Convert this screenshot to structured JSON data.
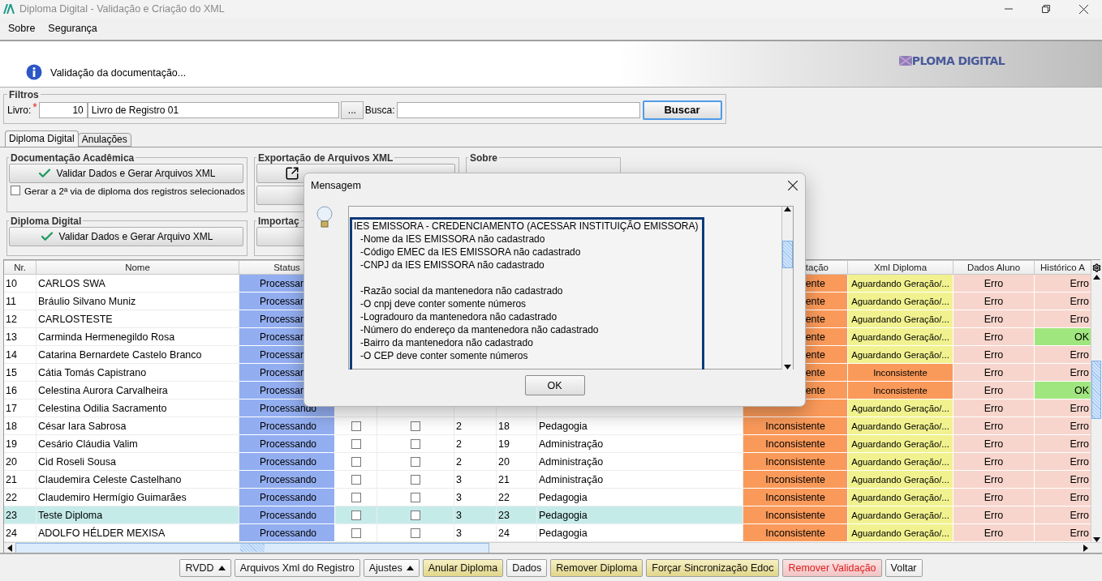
{
  "window": {
    "title": "Diploma Digital - Validação e Criação do XML"
  },
  "menu": [
    "Sobre",
    "Segurança"
  ],
  "banner": {
    "message": "Validação da documentação...",
    "logo": "PLOMA DIGITAL"
  },
  "filters": {
    "title": "Filtros",
    "livro_label": "Livro:",
    "required_mark": "*",
    "livro_number": "10",
    "livro_name": "Livro de Registro 01",
    "browse": "...",
    "search_label": "Busca:",
    "search_button": "Buscar"
  },
  "tabs": [
    {
      "label": "Diploma Digital",
      "selected": true
    },
    {
      "label": "Anulações",
      "selected": false
    }
  ],
  "groups": {
    "documentacao": {
      "title": "Documentação Acadêmica",
      "button": "Validar Dados e Gerar Arquivos XML",
      "checkbox": {
        "label": "Gerar a 2ª via de diploma dos registros selecionados",
        "checked": false
      }
    },
    "exportacao": {
      "title": "Exportação de Arquivos XML"
    },
    "sobre": {
      "title": "Sobre"
    },
    "diploma": {
      "title": "Diploma Digital",
      "button": "Validar Dados e Gerar Arquivo XML"
    },
    "importacao": {
      "title": "Importaç"
    }
  },
  "table": {
    "columns": [
      {
        "label": "Nr."
      },
      {
        "label": "Nome"
      },
      {
        "label": "Status"
      },
      {},
      {},
      {},
      {},
      {},
      {
        "label": "tação"
      },
      {
        "label": "Xml Diploma"
      },
      {
        "label": "Dados Aluno"
      },
      {
        "label": "Histórico A"
      }
    ],
    "rows": [
      {
        "nr": "10",
        "name": "CARLOS SWA",
        "selected": false,
        "status": {
          "text": "Processan"
        },
        "doc": {
          "text": "ente"
        },
        "xml": {
          "text": "Aguardando Geração/...",
          "kind": "pending"
        },
        "dados": {
          "text": "Erro",
          "kind": "error"
        },
        "hist": {
          "text": "Erro",
          "kind": "error"
        }
      },
      {
        "nr": "11",
        "name": "Bráulio Silvano Muniz",
        "selected": false,
        "status": {
          "text": "Processan"
        },
        "doc": {
          "text": "ente"
        },
        "xml": {
          "text": "Aguardando Geração/...",
          "kind": "pending"
        },
        "dados": {
          "text": "Erro",
          "kind": "error"
        },
        "hist": {
          "text": "Erro",
          "kind": "error"
        }
      },
      {
        "nr": "12",
        "name": "CARLOSTESTE",
        "selected": false,
        "status": {
          "text": "Processan"
        },
        "doc": {
          "text": "ente"
        },
        "xml": {
          "text": "Aguardando Geração/...",
          "kind": "pending"
        },
        "dados": {
          "text": "Erro",
          "kind": "error"
        },
        "hist": {
          "text": "Erro",
          "kind": "error"
        }
      },
      {
        "nr": "13",
        "name": "Carminda Hermenegildo Rosa",
        "selected": false,
        "status": {
          "text": "Processan"
        },
        "doc": {
          "text": "ente"
        },
        "xml": {
          "text": "Aguardando Geração/...",
          "kind": "pending"
        },
        "dados": {
          "text": "Erro",
          "kind": "error"
        },
        "hist": {
          "text": "OK",
          "kind": "ok"
        }
      },
      {
        "nr": "14",
        "name": "Catarina Bernardete Castelo Branco",
        "selected": false,
        "status": {
          "text": "Processan"
        },
        "doc": {
          "text": "ente"
        },
        "xml": {
          "text": "Aguardando Geração/...",
          "kind": "pending"
        },
        "dados": {
          "text": "Erro",
          "kind": "error"
        },
        "hist": {
          "text": "Erro",
          "kind": "error"
        }
      },
      {
        "nr": "15",
        "name": "Cátia Tomás Capistrano",
        "selected": false,
        "status": {
          "text": "Processan"
        },
        "doc": {
          "text": "ente"
        },
        "xml": {
          "text": "Inconsistente",
          "kind": "inconsistent"
        },
        "dados": {
          "text": "Erro",
          "kind": "error"
        },
        "hist": {
          "text": "Erro",
          "kind": "error"
        }
      },
      {
        "nr": "16",
        "name": "Celestina Aurora Carvalheira",
        "selected": false,
        "status": {
          "text": "Processan"
        },
        "doc": {
          "text": "ente"
        },
        "xml": {
          "text": "Inconsistente",
          "kind": "inconsistent"
        },
        "dados": {
          "text": "Erro",
          "kind": "error"
        },
        "hist": {
          "text": "OK",
          "kind": "ok"
        }
      },
      {
        "nr": "17",
        "name": "Celestina Odilia Sacramento",
        "selected": false,
        "status": {
          "text": "Processando"
        },
        "xml": {
          "text": "Aguardando Geração/...",
          "kind": "pending"
        },
        "dados": {
          "text": "Erro",
          "kind": "error"
        },
        "hist": {
          "text": "Erro",
          "kind": "error"
        }
      },
      {
        "nr": "18",
        "name": "César Iara Sabrosa",
        "selected": false,
        "status": {
          "text": "Processando"
        },
        "check_a": false,
        "check_b": false,
        "col_6": "2",
        "col_7": "18",
        "course": "Pedagogia",
        "doc": {
          "text": "Inconsistente"
        },
        "xml": {
          "text": "Aguardando Geração/...",
          "kind": "pending"
        },
        "dados": {
          "text": "Erro",
          "kind": "error"
        },
        "hist": {
          "text": "Erro",
          "kind": "error"
        }
      },
      {
        "nr": "19",
        "name": "Cesário Cláudia Valim",
        "selected": false,
        "status": {
          "text": "Processando"
        },
        "check_a": false,
        "check_b": false,
        "col_6": "2",
        "col_7": "19",
        "course": "Administração",
        "doc": {
          "text": "Inconsistente"
        },
        "xml": {
          "text": "Aguardando Geração/...",
          "kind": "pending"
        },
        "dados": {
          "text": "Erro",
          "kind": "error"
        },
        "hist": {
          "text": "Erro",
          "kind": "error"
        }
      },
      {
        "nr": "20",
        "name": "Cid Roseli Sousa",
        "selected": false,
        "status": {
          "text": "Processando"
        },
        "check_a": false,
        "check_b": false,
        "col_6": "2",
        "col_7": "20",
        "course": "Administração",
        "doc": {
          "text": "Inconsistente"
        },
        "xml": {
          "text": "Aguardando Geração/...",
          "kind": "pending"
        },
        "dados": {
          "text": "Erro",
          "kind": "error"
        },
        "hist": {
          "text": "Erro",
          "kind": "error"
        }
      },
      {
        "nr": "21",
        "name": "Claudemira Celeste Castelhano",
        "selected": false,
        "status": {
          "text": "Processando"
        },
        "check_a": false,
        "check_b": false,
        "col_6": "3",
        "col_7": "21",
        "course": "Administração",
        "doc": {
          "text": "Inconsistente"
        },
        "xml": {
          "text": "Aguardando Geração/...",
          "kind": "pending"
        },
        "dados": {
          "text": "Erro",
          "kind": "error"
        },
        "hist": {
          "text": "Erro",
          "kind": "error"
        }
      },
      {
        "nr": "22",
        "name": "Claudemiro Hermígio Guimarães",
        "selected": false,
        "status": {
          "text": "Processando"
        },
        "check_a": false,
        "check_b": false,
        "col_6": "3",
        "col_7": "22",
        "course": "Pedagogia",
        "doc": {
          "text": "Inconsistente"
        },
        "xml": {
          "text": "Aguardando Geração/...",
          "kind": "pending"
        },
        "dados": {
          "text": "Erro",
          "kind": "error"
        },
        "hist": {
          "text": "Erro",
          "kind": "error"
        }
      },
      {
        "nr": "23",
        "name": "Teste Diploma",
        "selected": true,
        "status": {
          "text": "Processando"
        },
        "check_a": false,
        "check_b": false,
        "col_6": "3",
        "col_7": "23",
        "course": "Pedagogia",
        "doc": {
          "text": "Inconsistente"
        },
        "xml": {
          "text": "Aguardando Geração/...",
          "kind": "pending"
        },
        "dados": {
          "text": "Erro",
          "kind": "error"
        },
        "hist": {
          "text": "Erro",
          "kind": "error"
        }
      },
      {
        "nr": "24",
        "name": "ADOLFO HÉLDER MEXISA",
        "selected": false,
        "status": {
          "text": "Processando"
        },
        "check_a": false,
        "check_b": false,
        "col_6": "3",
        "col_7": "24",
        "course": "Pedagogia",
        "doc": {
          "text": "Inconsistente"
        },
        "xml": {
          "text": "Aguardando Geração/...",
          "kind": "pending"
        },
        "dados": {
          "text": "Erro",
          "kind": "error"
        },
        "hist": {
          "text": "Erro",
          "kind": "error"
        }
      }
    ]
  },
  "buttons": [
    {
      "label": "RVDD",
      "kind": "menu"
    },
    {
      "label": "Arquivos Xml do Registro",
      "kind": "plain"
    },
    {
      "label": "Ajustes",
      "kind": "menu"
    },
    {
      "label": "Anular Diploma",
      "kind": "warning"
    },
    {
      "label": "Dados",
      "kind": "plain"
    },
    {
      "label": "Remover Diploma",
      "kind": "warning"
    },
    {
      "label": "Forçar Sincronização Edoc",
      "kind": "warning"
    },
    {
      "label": "Remover Validação",
      "kind": "danger"
    },
    {
      "label": "Voltar",
      "kind": "plain"
    }
  ],
  "dialog": {
    "title": "Mensagem",
    "heading": "IES EMISSORA - CREDENCIAMENTO (ACESSAR INSTITUIÇÃO EMISSORA)",
    "groups": [
      [
        "-Nome da IES EMISSORA não cadastrado",
        "-Código EMEC da IES EMISSORA não cadastrado",
        "-CNPJ da IES EMISSORA não cadastrado"
      ],
      [
        "-Razão social da mantenedora não cadastrado",
        "-O cnpj deve conter somente números",
        "-Logradouro da mantenedora não cadastrado",
        "-Número do endereço da mantenedora não cadastrado",
        "-Bairro da mantenedora não cadastrado",
        "-O CEP deve conter somente números"
      ]
    ],
    "ok": "OK"
  }
}
